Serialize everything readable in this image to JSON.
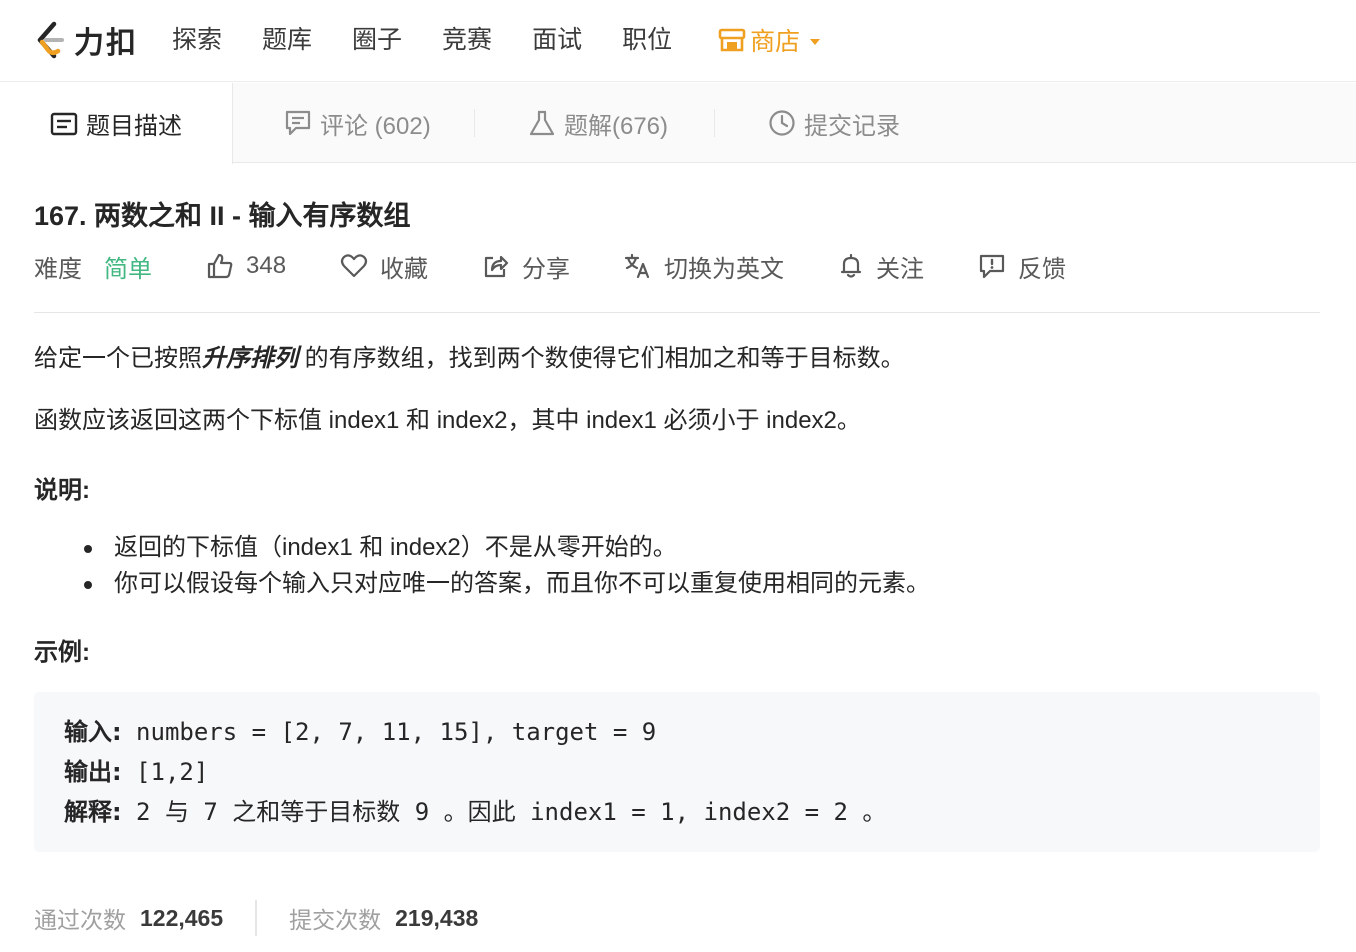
{
  "nav": {
    "brand": "力扣",
    "links": [
      "探索",
      "题库",
      "圈子",
      "竞赛",
      "面试",
      "职位"
    ],
    "store": "商店"
  },
  "tabs": {
    "description": "题目描述",
    "comments": "评论 (602)",
    "solutions": "题解(676)",
    "submissions": "提交记录"
  },
  "problem": {
    "title": "167. 两数之和 II - 输入有序数组",
    "difficulty_label": "难度",
    "difficulty": "简单",
    "likes": "348",
    "favorite": "收藏",
    "share": "分享",
    "switch_lang": "切换为英文",
    "follow": "关注",
    "feedback": "反馈"
  },
  "description": {
    "p1_before": "给定一个已按照",
    "p1_emph": "升序排列",
    "p1_after": " 的有序数组，找到两个数使得它们相加之和等于目标数。",
    "p2": "函数应该返回这两个下标值 index1 和 index2，其中 index1 必须小于 index2。",
    "notes_heading": "说明:",
    "notes": [
      "返回的下标值（index1 和 index2）不是从零开始的。",
      "你可以假设每个输入只对应唯一的答案，而且你不可以重复使用相同的元素。"
    ],
    "example_heading": "示例:"
  },
  "example": {
    "input_label": "输入:",
    "input": " numbers = [2, 7, 11, 15], target = 9",
    "output_label": "输出:",
    "output": " [1,2]",
    "explain_label": "解释:",
    "explain": " 2 与 7 之和等于目标数 9 。因此 index1 = 1, index2 = 2 。"
  },
  "stats": {
    "accepted_label": "通过次数",
    "accepted": "122,465",
    "submitted_label": "提交次数",
    "submitted": "219,438"
  },
  "colors": {
    "easy": "#43b883",
    "store": "#f0a020"
  }
}
